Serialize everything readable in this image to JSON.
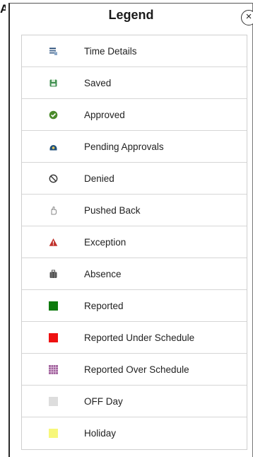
{
  "legend": {
    "title": "Legend",
    "close_icon_glyph": "×",
    "items": [
      {
        "label": "Time Details",
        "icon": "time-details-icon"
      },
      {
        "label": "Saved",
        "icon": "saved-icon",
        "color": "#3f8f4f"
      },
      {
        "label": "Approved",
        "icon": "approved-icon",
        "color": "#4a8a2a"
      },
      {
        "label": "Pending Approvals",
        "icon": "pending-approvals-icon",
        "color": "#1f4f7a"
      },
      {
        "label": "Denied",
        "icon": "denied-icon",
        "color": "#333333"
      },
      {
        "label": "Pushed Back",
        "icon": "pushed-back-icon",
        "color": "#888888"
      },
      {
        "label": "Exception",
        "icon": "exception-icon",
        "color": "#c0302a"
      },
      {
        "label": "Absence",
        "icon": "absence-icon",
        "color": "#555555"
      },
      {
        "label": "Reported",
        "icon": "reported-swatch",
        "color": "#0e7a0e"
      },
      {
        "label": "Reported Under Schedule",
        "icon": "reported-under-schedule-swatch",
        "color": "#ee1111"
      },
      {
        "label": "Reported Over Schedule",
        "icon": "reported-over-schedule-swatch",
        "color": "#a3659f"
      },
      {
        "label": "OFF Day",
        "icon": "off-day-swatch",
        "color": "#dddddd"
      },
      {
        "label": "Holiday",
        "icon": "holiday-swatch",
        "color": "#f7f77a"
      }
    ]
  }
}
